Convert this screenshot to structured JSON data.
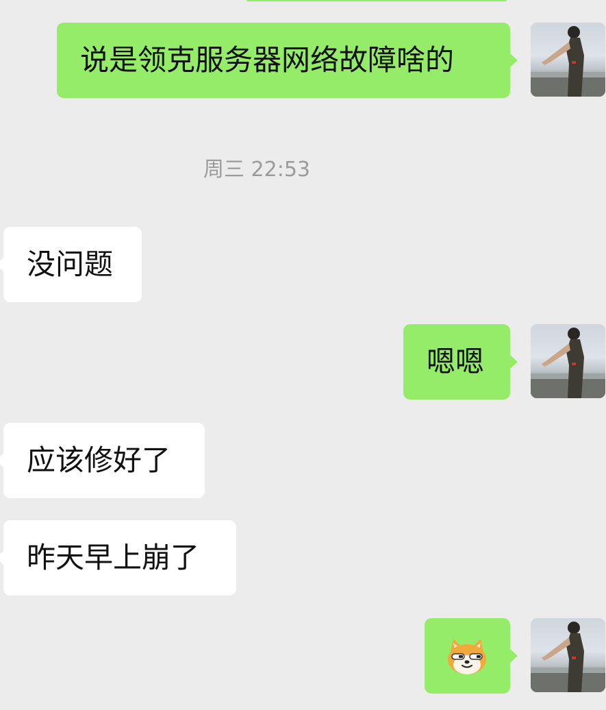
{
  "conversation": {
    "timestamp": "周三 22:53",
    "messages": [
      {
        "direction": "sent",
        "text": "说是领克服务器网络故障啥的"
      },
      {
        "direction": "received",
        "text": "没问题"
      },
      {
        "direction": "sent",
        "text": "嗯嗯"
      },
      {
        "direction": "received",
        "text": "应该修好了"
      },
      {
        "direction": "received",
        "text": "昨天早上崩了"
      },
      {
        "direction": "sent",
        "sticker": "shiba-dog-emoji"
      }
    ]
  },
  "icons": {
    "avatar": "user-avatar-photo",
    "sticker": "shiba-dog-emoji-icon"
  },
  "colors": {
    "background": "#ececec",
    "sent_bubble": "#95ec69",
    "received_bubble": "#ffffff",
    "timestamp_text": "#9b9b9b"
  }
}
